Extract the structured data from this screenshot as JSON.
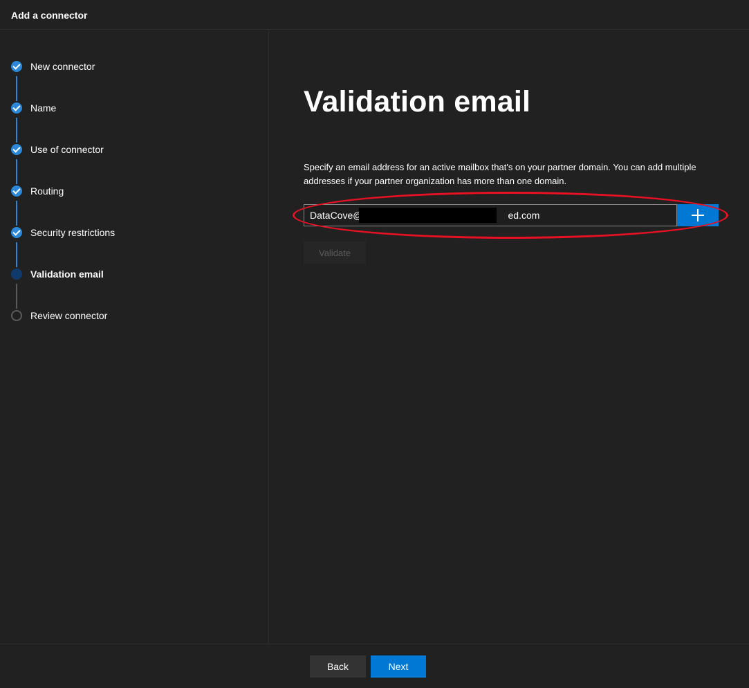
{
  "header": {
    "title": "Add a connector"
  },
  "steps": [
    {
      "label": "New connector",
      "state": "done"
    },
    {
      "label": "Name",
      "state": "done"
    },
    {
      "label": "Use of connector",
      "state": "done"
    },
    {
      "label": "Routing",
      "state": "done"
    },
    {
      "label": "Security restrictions",
      "state": "done"
    },
    {
      "label": "Validation email",
      "state": "current"
    },
    {
      "label": "Review connector",
      "state": "pending"
    }
  ],
  "main": {
    "title": "Validation email",
    "description": "Specify an email address for an active mailbox that's on your partner domain. You can add multiple addresses if your partner organization has more than one domain.",
    "email_value": "DataCove@                                                      ed.com",
    "add_icon": "plus-icon",
    "validate_label": "Validate"
  },
  "footer": {
    "back_label": "Back",
    "next_label": "Next"
  },
  "colors": {
    "accent": "#0078d4",
    "step_done": "#2b88d8",
    "highlight": "#e81123",
    "background": "#212121"
  }
}
